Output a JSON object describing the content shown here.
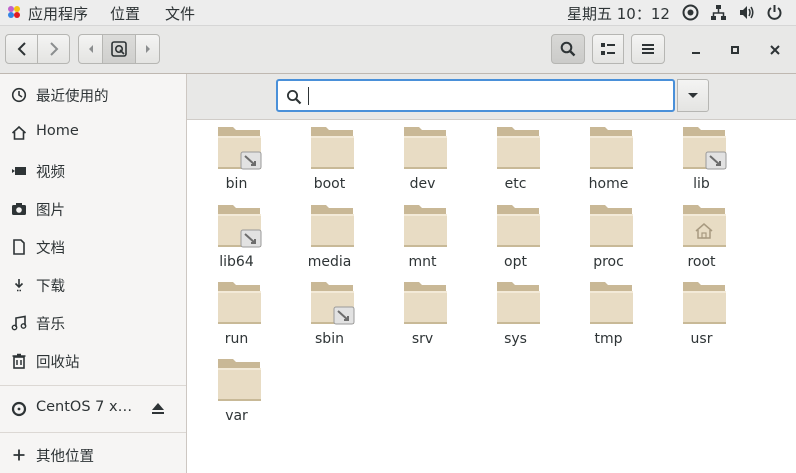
{
  "topbar": {
    "apps_label": "应用程序",
    "places_label": "位置",
    "files_label": "文件",
    "clock": "星期五 10：12"
  },
  "sidebar": {
    "items": [
      {
        "label": "最近使用的",
        "icon": "recent-icon"
      },
      {
        "label": "Home",
        "icon": "home-icon"
      },
      {
        "label": "视频",
        "icon": "video-icon"
      },
      {
        "label": "图片",
        "icon": "camera-icon"
      },
      {
        "label": "文档",
        "icon": "document-icon"
      },
      {
        "label": "下载",
        "icon": "download-icon"
      },
      {
        "label": "音乐",
        "icon": "music-icon"
      },
      {
        "label": "回收站",
        "icon": "trash-icon"
      }
    ],
    "device": {
      "label": "CentOS 7 x…",
      "icon": "disc-icon"
    },
    "other": {
      "label": "其他位置",
      "icon": "plus-icon"
    }
  },
  "search": {
    "value": "",
    "placeholder": ""
  },
  "files": [
    {
      "name": "bin",
      "type": "link"
    },
    {
      "name": "boot",
      "type": "folder"
    },
    {
      "name": "dev",
      "type": "folder"
    },
    {
      "name": "etc",
      "type": "folder"
    },
    {
      "name": "home",
      "type": "folder"
    },
    {
      "name": "lib",
      "type": "link"
    },
    {
      "name": "lib64",
      "type": "link"
    },
    {
      "name": "media",
      "type": "folder"
    },
    {
      "name": "mnt",
      "type": "folder"
    },
    {
      "name": "opt",
      "type": "folder"
    },
    {
      "name": "proc",
      "type": "folder"
    },
    {
      "name": "root",
      "type": "home"
    },
    {
      "name": "run",
      "type": "folder"
    },
    {
      "name": "sbin",
      "type": "link"
    },
    {
      "name": "srv",
      "type": "folder"
    },
    {
      "name": "sys",
      "type": "folder"
    },
    {
      "name": "tmp",
      "type": "folder"
    },
    {
      "name": "usr",
      "type": "folder"
    },
    {
      "name": "var",
      "type": "folder"
    }
  ],
  "colors": {
    "accent": "#4a90d9",
    "folder": "#e8dcc4",
    "folder_tab": "#c9b896"
  }
}
